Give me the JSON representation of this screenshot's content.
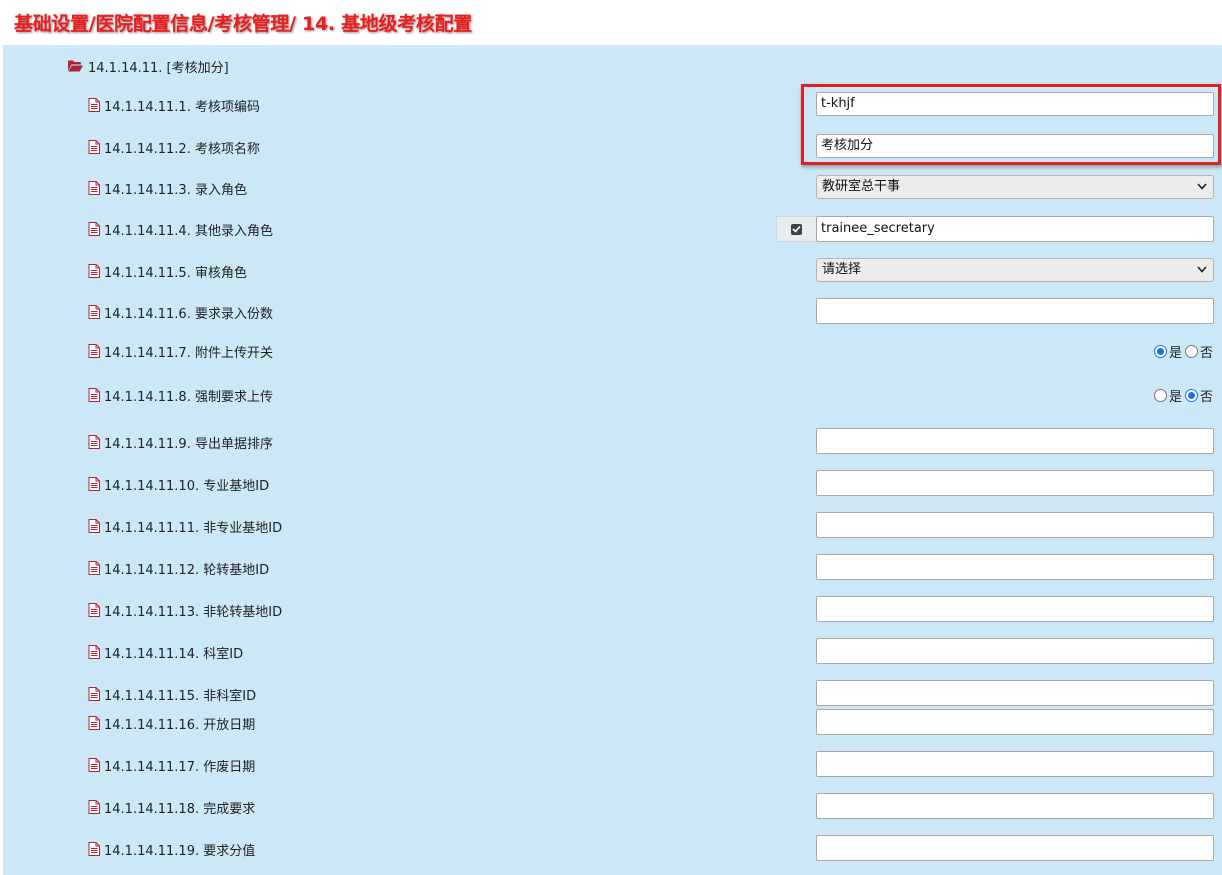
{
  "page": {
    "title": "基础设置/医院配置信息/考核管理/ 14. 基地级考核配置"
  },
  "section": {
    "label": "14.1.14.11. [考核加分]"
  },
  "rows": [
    {
      "label": "14.1.14.11.1. 考核项编码",
      "value": "t-khjf"
    },
    {
      "label": "14.1.14.11.2. 考核项名称",
      "value": "考核加分"
    },
    {
      "label": "14.1.14.11.3. 录入角色",
      "value": "教研室总干事"
    },
    {
      "label": "14.1.14.11.4. 其他录入角色",
      "value": "trainee_secretary",
      "checked": true
    },
    {
      "label": "14.1.14.11.5. 审核角色",
      "value": "请选择"
    },
    {
      "label": "14.1.14.11.6. 要求录入份数",
      "value": ""
    },
    {
      "label": "14.1.14.11.7. 附件上传开关",
      "selected": "是"
    },
    {
      "label": "14.1.14.11.8. 强制要求上传",
      "selected": "否"
    },
    {
      "label": "14.1.14.11.9. 导出单据排序",
      "value": ""
    },
    {
      "label": "14.1.14.11.10. 专业基地ID",
      "value": ""
    },
    {
      "label": "14.1.14.11.11. 非专业基地ID",
      "value": ""
    },
    {
      "label": "14.1.14.11.12. 轮转基地ID",
      "value": ""
    },
    {
      "label": "14.1.14.11.13. 非轮转基地ID",
      "value": ""
    },
    {
      "label": "14.1.14.11.14. 科室ID",
      "value": ""
    },
    {
      "label": "14.1.14.11.15. 非科室ID",
      "value": ""
    },
    {
      "label": "14.1.14.11.16. 开放日期",
      "value": ""
    },
    {
      "label": "14.1.14.11.17. 作废日期",
      "value": ""
    },
    {
      "label": "14.1.14.11.18. 完成要求",
      "value": ""
    },
    {
      "label": "14.1.14.11.19. 要求分值",
      "value": ""
    }
  ],
  "radio_options": {
    "yes": "是",
    "no": "否"
  },
  "icons": {
    "folder": "folder-open-icon",
    "document": "document-icon",
    "check": "checkbox-checked-icon",
    "chevron": "chevron-down-icon"
  },
  "colors": {
    "title": "#ee1c1c",
    "panel": "#cce8f6",
    "icon": "#b0243a",
    "highlight": "#e02020"
  }
}
